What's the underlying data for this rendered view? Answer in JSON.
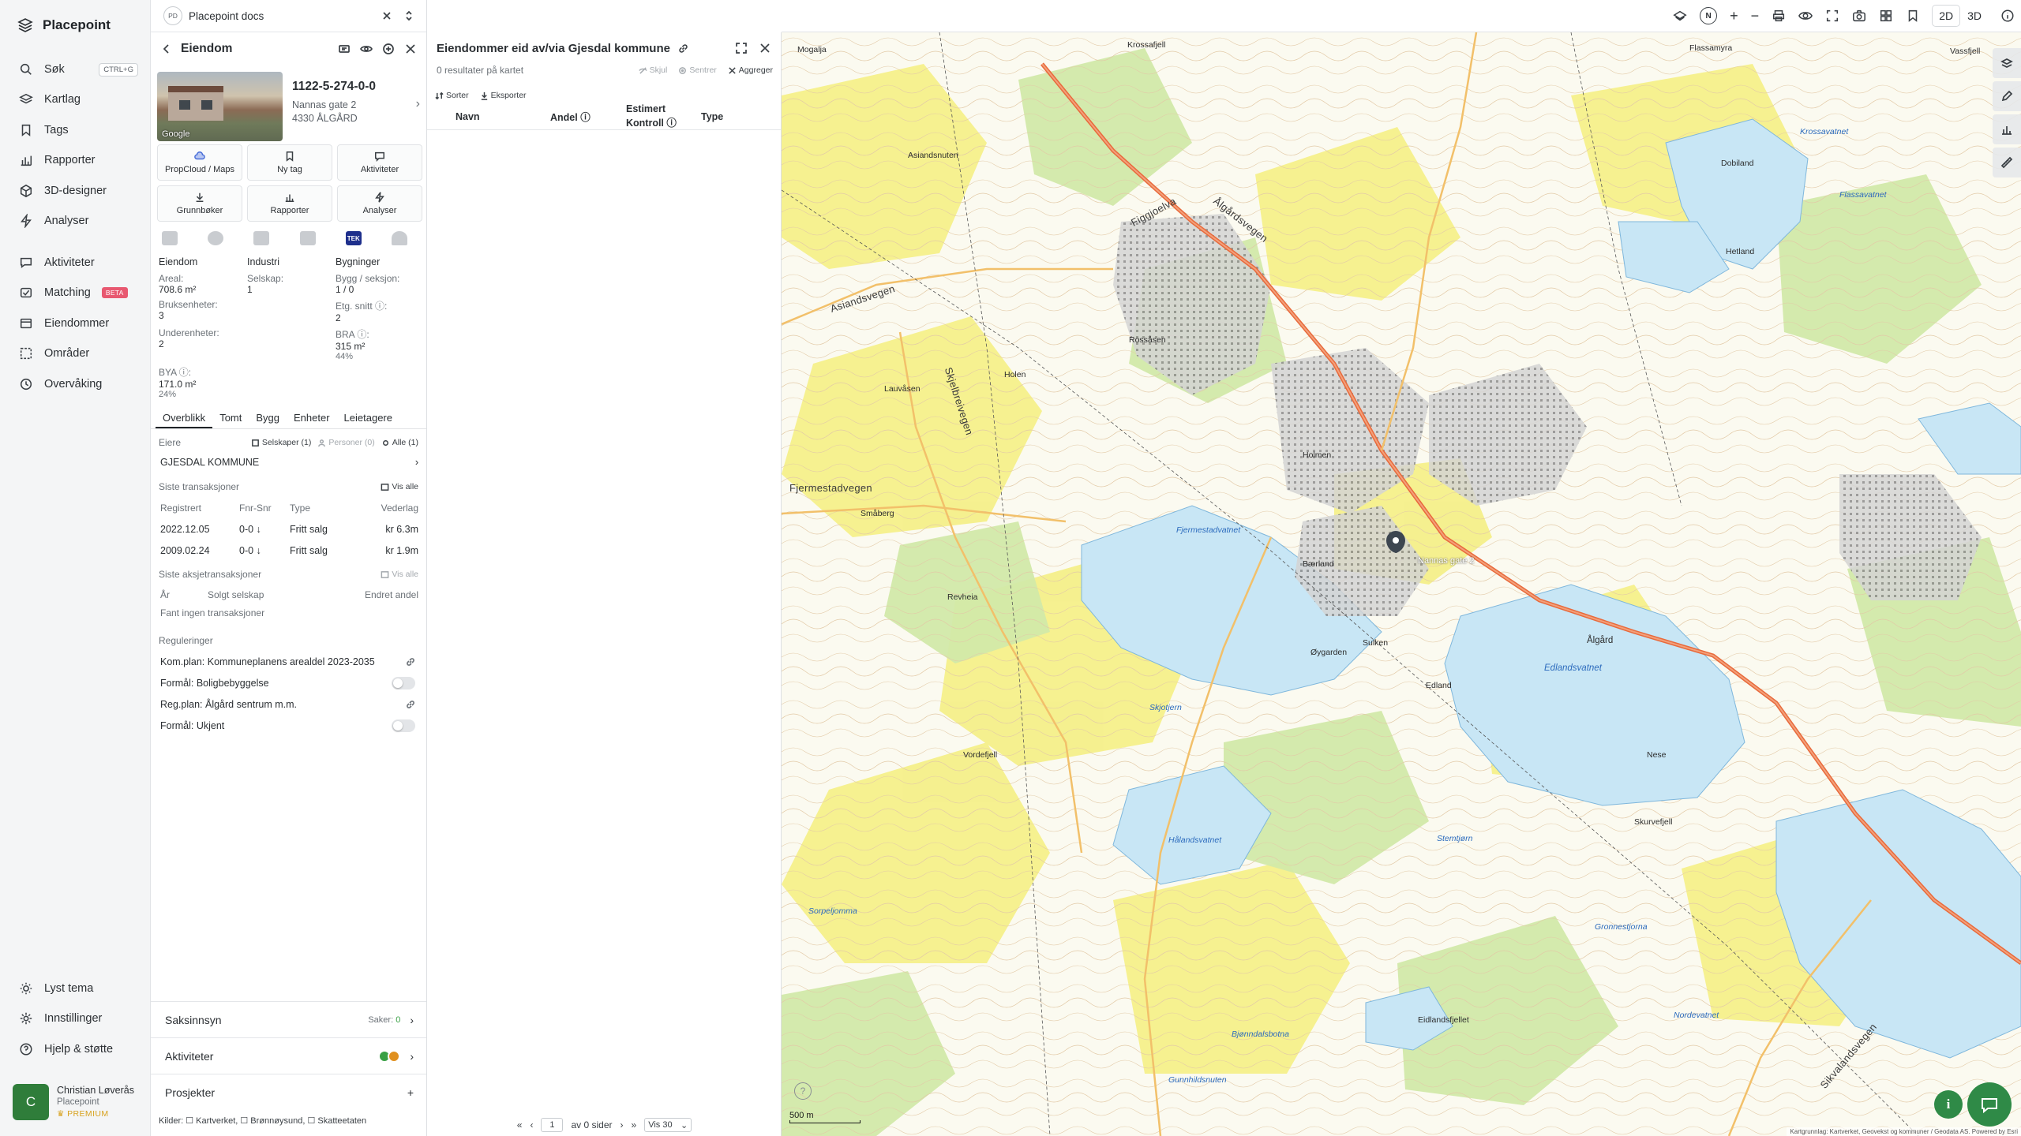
{
  "nav": {
    "brand": "Placepoint",
    "items": [
      {
        "label": "Søk",
        "kbd": "CTRL+G"
      },
      {
        "label": "Kartlag"
      },
      {
        "label": "Tags"
      },
      {
        "label": "Rapporter"
      },
      {
        "label": "3D-designer"
      },
      {
        "label": "Analyser"
      },
      {
        "label": "Aktiviteter"
      },
      {
        "label": "Matching",
        "badge": "BETA"
      },
      {
        "label": "Eiendommer"
      },
      {
        "label": "Områder"
      },
      {
        "label": "Overvåking"
      }
    ],
    "bottom": [
      {
        "label": "Lyst tema"
      },
      {
        "label": "Innstillinger"
      },
      {
        "label": "Hjelp & støtte"
      }
    ],
    "user": {
      "initial": "C",
      "name": "Christian Løverås",
      "org": "Placepoint",
      "plan": "PREMIUM"
    }
  },
  "workspace": {
    "badge": "PD",
    "name": "Placepoint docs"
  },
  "detail": {
    "title": "Eiendom",
    "id": "1122-5-274-0-0",
    "address": "Nannas gate 2",
    "postal": "4330 ÅLGÅRD",
    "photo_credit": "Google",
    "actions": [
      "PropCloud / Maps",
      "Ny tag",
      "Aktiviteter",
      "Grunnbøker",
      "Rapporter",
      "Analyser"
    ],
    "logo_tek": "TEK",
    "stats": {
      "col1_head": "Eiendom",
      "areal_k": "Areal:",
      "areal_v": "708.6 m²",
      "bruks_k": "Bruksenheter:",
      "bruks_v": "3",
      "under_k": "Underenheter:",
      "under_v": "2",
      "bya_k": "BYA ⓘ:",
      "bya_v": "171.0 m²",
      "bya_p": "24%",
      "col2_head": "Industri",
      "selskap_k": "Selskap:",
      "selskap_v": "1",
      "col3_head": "Bygninger",
      "bygg_k": "Bygg / seksjon:",
      "bygg_v": "1 / 0",
      "etg_k": "Etg. snitt ⓘ:",
      "etg_v": "2",
      "bra_k": "BRA ⓘ:",
      "bra_v": "315 m²",
      "bra_p": "44%"
    },
    "tabs": [
      "Overblikk",
      "Tomt",
      "Bygg",
      "Enheter",
      "Leietagere"
    ],
    "owners": {
      "label": "Eiere",
      "companies": "Selskaper (1)",
      "persons": "Personer (0)",
      "all": "Alle (1)",
      "name": "GJESDAL KOMMUNE"
    },
    "transactions": {
      "label": "Siste transaksjoner",
      "show_all": "Vis alle",
      "headers": [
        "Registrert",
        "Fnr-Snr",
        "Type",
        "Vederlag"
      ],
      "rows": [
        [
          "2022.12.05",
          "0-0 ↓",
          "Fritt salg",
          "kr 6.3m"
        ],
        [
          "2009.02.24",
          "0-0 ↓",
          "Fritt salg",
          "kr 1.9m"
        ]
      ]
    },
    "share_tx": {
      "label": "Siste aksjetransaksjoner",
      "show_all": "Vis alle",
      "headers": [
        "År",
        "Solgt selskap",
        "Endret andel"
      ],
      "empty": "Fant ingen transaksjoner"
    },
    "regulations": {
      "label": "Reguleringer",
      "rows": [
        "Kom.plan: Kommuneplanens arealdel 2023-2035",
        "Formål: Boligbebyggelse",
        "Reg.plan: Ålgård sentrum m.m.",
        "Formål: Ukjent"
      ]
    },
    "folds": {
      "saksinnsyn": "Saksinnsyn",
      "saker_label": "Saker:",
      "saker_count": "0",
      "aktiviteter": "Aktiviteter",
      "prosjekter": "Prosjekter",
      "plus": "+"
    },
    "sources": "Kilder: ☐ Kartverket, ☐ Brønnøysund, ☐ Skatteetaten"
  },
  "list": {
    "title": "Eiendommer eid av/via Gjesdal kommune",
    "results": "0 resultater på kartet",
    "hide": "Skjul",
    "center": "Sentrer",
    "aggregate": "Aggreger",
    "sort": "Sorter",
    "export": "Eksporter",
    "columns": [
      "Navn",
      "Andel ⓘ",
      "Estimert Kontroll ⓘ",
      "Type"
    ],
    "page": "1",
    "of_pages": "av 0 sider",
    "per_page": "Vis 30"
  },
  "topbar": {
    "compass": "N",
    "plus": "+",
    "minus": "−",
    "mode_2d": "2D",
    "mode_3d": "3D"
  },
  "map": {
    "labels": [
      "Mogalja",
      "Krossafjell",
      "Flassamyra",
      "Vassfjell",
      "Krossavatnet",
      "Flassavatnet",
      "Asiandsnuten",
      "Figgjoelva",
      "Ålgårdsvegen",
      "Ålgård",
      "Edlandsvatnet",
      "Asiandsvegen",
      "Skjelbreivegen",
      "Fjermestadvegen",
      "Fjermestadvatnet",
      "Bærland",
      "Revheia",
      "Øygarden",
      "Edland",
      "Sulken",
      "Nese",
      "Holmen",
      "Dobiland",
      "Skurvefjell",
      "Hålandsvatnet",
      "Sorpeljomma",
      "Bjønndalsbotna",
      "Eidlandsfjellet",
      "Gunnhildsnuten",
      "Stemtjørn",
      "Gronnestjorna",
      "Nordevatnet",
      "Sikvalandsvegen",
      "Skjotjern",
      "Vordefjell",
      "Hetland",
      "Småberg",
      "Lauvåsen",
      "Rossåsen",
      "Holen"
    ],
    "scale": "500 m",
    "attribution": "Kartgrunnlag: Kartverket, Geovekst og kommuner / Geodata AS. Powered by Esri",
    "pin_label": "Nannas gate 2"
  },
  "colors": {
    "accent": "#2f8a47",
    "beta": "#e85870",
    "water": "#c8e6f5",
    "road": "#e86a3c"
  }
}
